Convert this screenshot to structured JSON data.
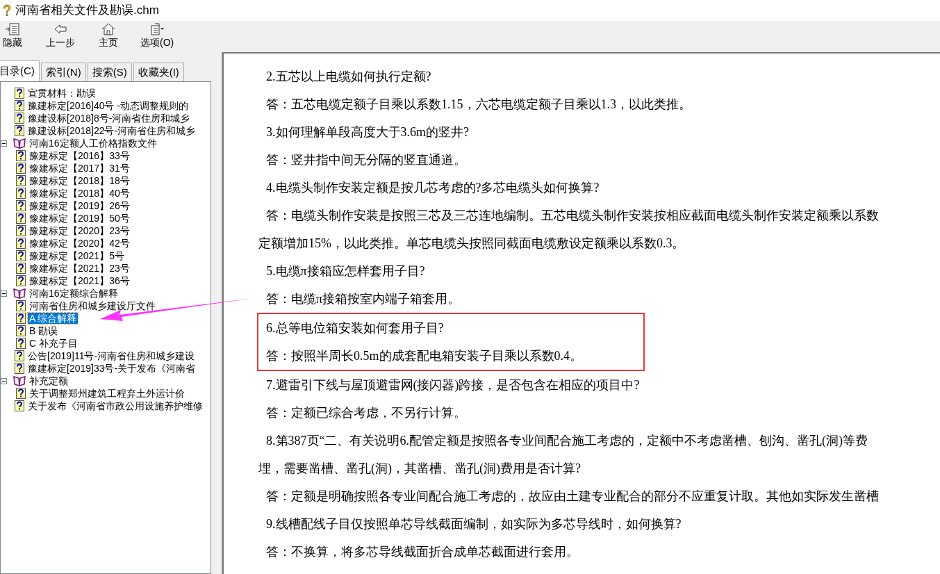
{
  "window": {
    "title": "河南省相关文件及勘误.chm"
  },
  "toolbar": [
    {
      "kind": "hide",
      "label": "隐藏"
    },
    {
      "kind": "back",
      "label": "上一步"
    },
    {
      "kind": "home",
      "label": "主页"
    },
    {
      "kind": "options",
      "label": "选项(O)"
    }
  ],
  "tabs": [
    {
      "label": "目录(C)",
      "selected": true
    },
    {
      "label": "索引(N)",
      "selected": false
    },
    {
      "label": "搜索(S)",
      "selected": false
    },
    {
      "label": "收藏夹(I)",
      "selected": false
    }
  ],
  "tree": [
    {
      "kind": "page",
      "label": "宣贯材料：勘误",
      "selected": false
    },
    {
      "kind": "page",
      "label": "豫建标定[2016]40号 -动态调整规则的",
      "selected": false
    },
    {
      "kind": "page",
      "label": "豫建设标[2018]8号-河南省住房和城乡",
      "selected": false
    },
    {
      "kind": "page",
      "label": "豫建设标[2018]22号-河南省住房和城乡",
      "selected": false
    },
    {
      "kind": "book",
      "label": "河南16定额人工价格指数文件",
      "expanded": true,
      "children": [
        {
          "kind": "page",
          "label": "豫建标定【2016】33号",
          "selected": false
        },
        {
          "kind": "page",
          "label": "豫建标定【2017】31号",
          "selected": false
        },
        {
          "kind": "page",
          "label": "豫建标定【2018】18号",
          "selected": false
        },
        {
          "kind": "page",
          "label": "豫建标定【2018】40号",
          "selected": false
        },
        {
          "kind": "page",
          "label": "豫建标定【2019】26号",
          "selected": false
        },
        {
          "kind": "page",
          "label": "豫建标定【2019】50号",
          "selected": false
        },
        {
          "kind": "page",
          "label": "豫建标定【2020】23号",
          "selected": false
        },
        {
          "kind": "page",
          "label": "豫建标定【2020】42号",
          "selected": false
        },
        {
          "kind": "page",
          "label": "豫建标定【2021】5号",
          "selected": false
        },
        {
          "kind": "page",
          "label": "豫建标定【2021】23号",
          "selected": false
        },
        {
          "kind": "page",
          "label": "豫建标定【2021】36号",
          "selected": false
        }
      ]
    },
    {
      "kind": "book",
      "label": "河南16定额综合解释",
      "expanded": true,
      "children": [
        {
          "kind": "page",
          "label": "河南省住房和城乡建设厅文件",
          "selected": false
        },
        {
          "kind": "page",
          "label": "A 综合解释",
          "selected": true
        },
        {
          "kind": "page",
          "label": "B 勘误",
          "selected": false
        },
        {
          "kind": "page",
          "label": "C 补充子目",
          "selected": false
        }
      ]
    },
    {
      "kind": "page",
      "label": "公告[2019]11号-河南省住房和城乡建设",
      "selected": false
    },
    {
      "kind": "page",
      "label": "豫建标定[2019]33号-关于发布《河南省",
      "selected": false
    },
    {
      "kind": "book",
      "label": "补充定额",
      "expanded": true,
      "children": [
        {
          "kind": "page",
          "label": "关于调整郑州建筑工程弃土外运计价",
          "selected": false
        }
      ]
    },
    {
      "kind": "page",
      "label": "关于发布《河南省市政公用设施养护维修",
      "selected": false
    }
  ],
  "content": [
    {
      "boxed": false,
      "lines": [
        "2.五芯以上电缆如何执行定额?"
      ]
    },
    {
      "boxed": false,
      "lines": [
        "答：五芯电缆定额子目乘以系数1.15，六芯电缆定额子目乘以1.3，以此类推。"
      ]
    },
    {
      "boxed": false,
      "lines": [
        "3.如何理解单段高度大于3.6m的竖井?"
      ]
    },
    {
      "boxed": false,
      "lines": [
        "答：竖井指中间无分隔的竖直通道。"
      ]
    },
    {
      "boxed": false,
      "lines": [
        "4.电缆头制作安装定额是按几芯考虑的?多芯电缆头如何换算?"
      ]
    },
    {
      "boxed": false,
      "lines": [
        "答：电缆头制作安装是按照三芯及三芯连地编制。五芯电缆头制作安装按相应截面电缆头制作安装定额乘以系数",
        "定额增加15%，以此类推。单芯电缆头按照同截面电缆敷设定额乘以系数0.3。"
      ]
    },
    {
      "boxed": false,
      "lines": [
        "5.电缆π接箱应怎样套用子目?"
      ]
    },
    {
      "boxed": false,
      "lines": [
        "答：电缆π接箱按室内端子箱套用。"
      ]
    },
    {
      "boxed": true,
      "lines": [
        "6.总等电位箱安装如何套用子目?"
      ]
    },
    {
      "boxed": true,
      "lines": [
        "答：按照半周长0.5m的成套配电箱安装子目乘以系数0.4。"
      ]
    },
    {
      "boxed": false,
      "lines": [
        "7.避雷引下线与屋顶避雷网(接闪器)跨接，是否包含在相应的项目中?"
      ]
    },
    {
      "boxed": false,
      "lines": [
        "答：定额已综合考虑，不另行计算。"
      ]
    },
    {
      "boxed": false,
      "lines": [
        "8.第387页“二、有关说明6.配管定额是按照各专业间配合施工考虑的，定额中不考虑凿槽、刨沟、凿孔(洞)等费",
        "埋，需要凿槽、凿孔(洞)，其凿槽、凿孔(洞)费用是否计算?"
      ]
    },
    {
      "boxed": false,
      "lines": [
        "答：定额是明确按照各专业间配合施工考虑的，故应由土建专业配合的部分不应重复计取。其他如实际发生凿槽"
      ]
    },
    {
      "boxed": false,
      "lines": [
        "9.线槽配线子目仅按照单芯导线截面编制，如实际为多芯导线时，如何换算?"
      ]
    },
    {
      "boxed": false,
      "lines": [
        "答：不换算，将多芯导线截面折合成单芯截面进行套用。"
      ]
    }
  ]
}
